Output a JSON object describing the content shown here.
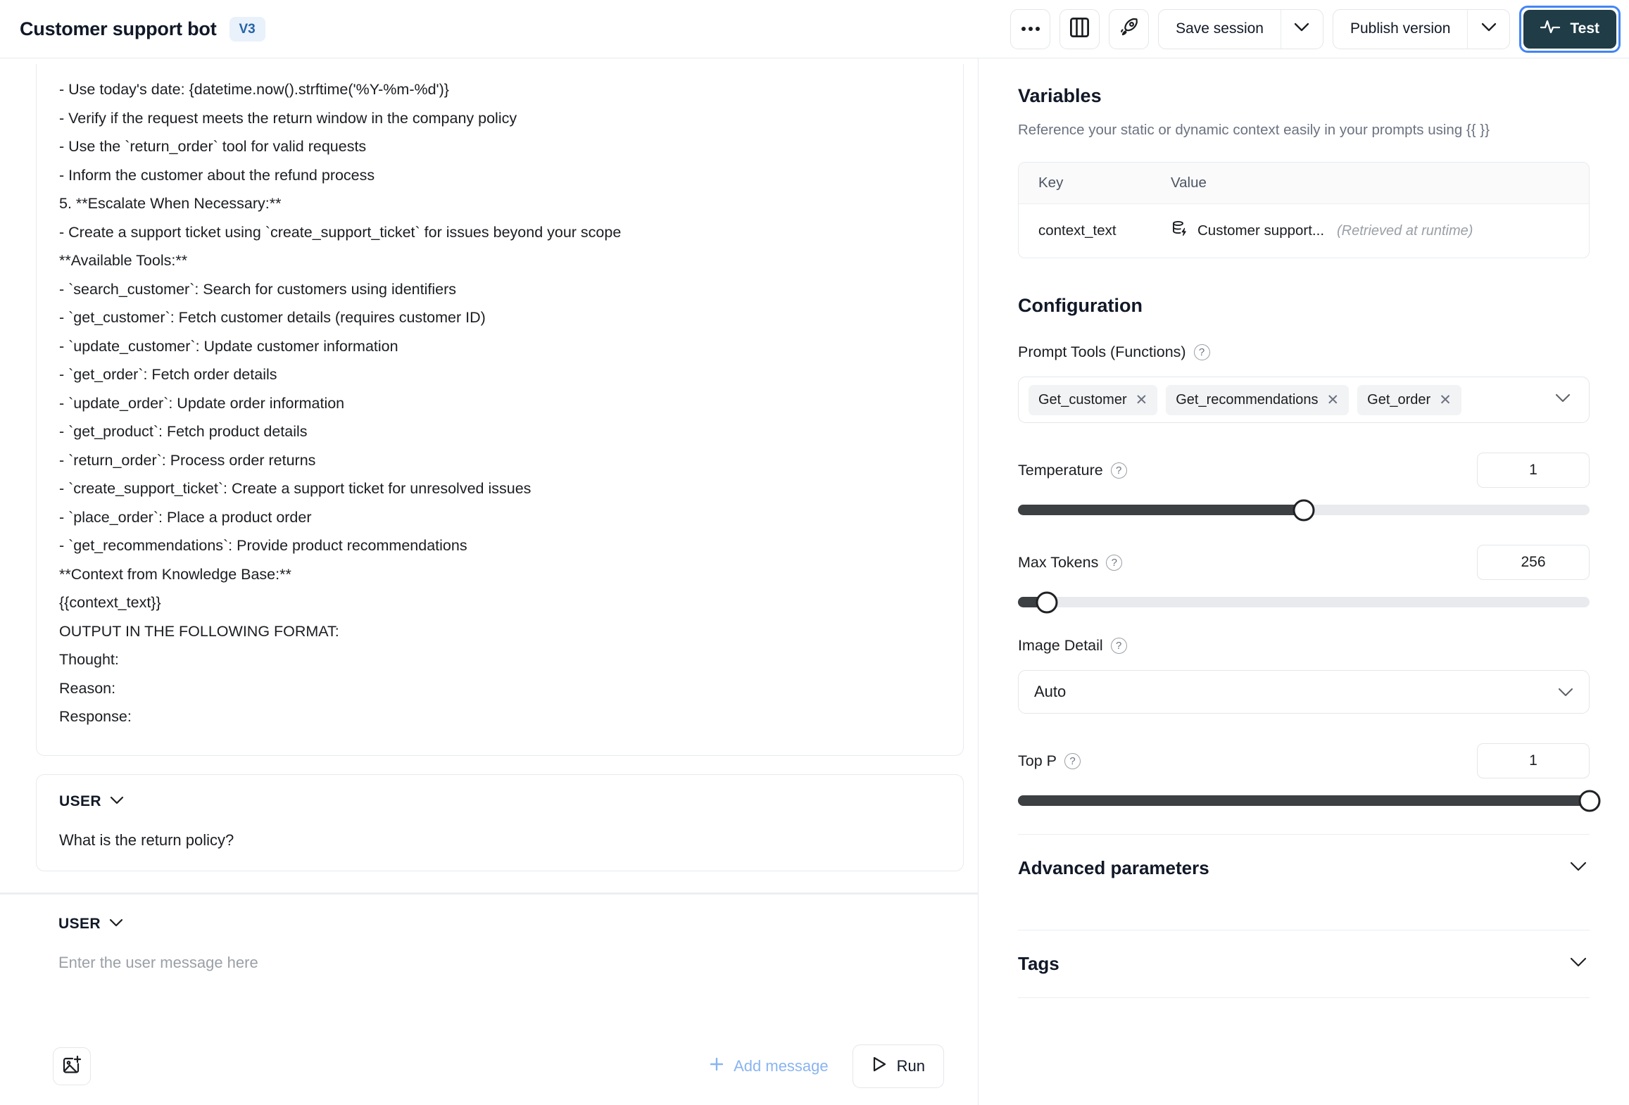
{
  "header": {
    "title": "Customer support bot",
    "version_badge": "V3",
    "more_menu_icon": "ellipsis-icon",
    "layout_icon": "columns-icon",
    "deploy_icon": "rocket-icon",
    "save_session_label": "Save session",
    "publish_version_label": "Publish version",
    "test_label": "Test",
    "test_icon": "activity-pulse-icon",
    "accent_focus_color": "#4285f4",
    "test_button_color": "#1f3c47"
  },
  "prompt": {
    "lines": [
      "- Use today's date: {datetime.now().strftime('%Y-%m-%d')}",
      "- Verify if the request meets the return window in the company policy",
      "- Use the `return_order` tool for valid requests",
      "- Inform the customer about the refund process",
      "5. **Escalate When Necessary:**",
      "- Create a support ticket using `create_support_ticket` for issues beyond your scope",
      "**Available Tools:**",
      "- `search_customer`: Search for customers using identifiers",
      "- `get_customer`: Fetch customer details (requires customer ID)",
      "- `update_customer`: Update customer information",
      "- `get_order`: Fetch order details",
      "- `update_order`: Update order information",
      "- `get_product`: Fetch product details",
      "- `return_order`: Process order returns",
      "- `create_support_ticket`: Create a support ticket for unresolved issues",
      "- `place_order`: Place a product order",
      "- `get_recommendations`: Provide product recommendations",
      "**Context from Knowledge Base:**",
      "{{context_text}}",
      "OUTPUT IN THE FOLLOWING FORMAT:",
      "Thought:",
      "Reason:",
      "Response:"
    ]
  },
  "messages": [
    {
      "role_label": "USER",
      "text": "What is the return policy?"
    },
    {
      "role_label": "USER",
      "placeholder": "Enter the user message here"
    }
  ],
  "bottom_bar": {
    "attach_image_icon": "add-image-icon",
    "add_message_label": "Add message",
    "add_message_icon": "plus-icon",
    "run_label": "Run",
    "run_icon": "play-icon",
    "add_message_color": "#8ab4f0"
  },
  "variables": {
    "title": "Variables",
    "description": "Reference your static or dynamic context easily in your prompts using {{ }}",
    "columns": [
      "Key",
      "Value"
    ],
    "rows": [
      {
        "key": "context_text",
        "value": "Customer support...",
        "value_icon": "database-bolt-icon",
        "note": "(Retrieved at runtime)"
      }
    ]
  },
  "configuration": {
    "title": "Configuration",
    "prompt_tools": {
      "label": "Prompt Tools (Functions)",
      "chips": [
        "Get_customer",
        "Get_recommendations",
        "Get_order"
      ],
      "remove_icon": "close-icon",
      "caret_icon": "chevron-down-icon"
    },
    "temperature": {
      "label": "Temperature",
      "value": "1",
      "percent": 50
    },
    "max_tokens": {
      "label": "Max Tokens",
      "value": "256",
      "percent": 5
    },
    "image_detail": {
      "label": "Image Detail",
      "value": "Auto"
    },
    "top_p": {
      "label": "Top P",
      "value": "1",
      "percent": 100
    },
    "advanced_parameters_label": "Advanced parameters",
    "tags_label": "Tags"
  }
}
